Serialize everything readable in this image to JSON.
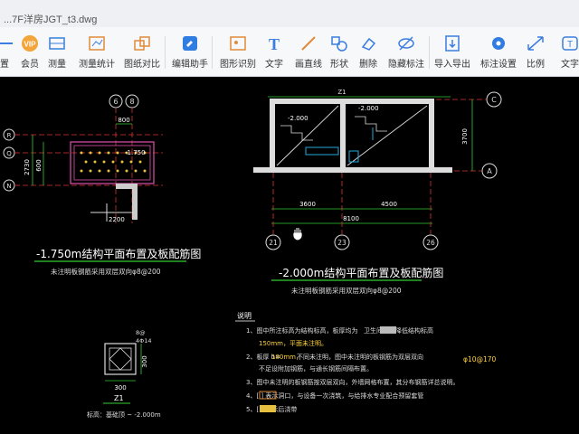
{
  "window": {
    "title": "...7F洋房JGT_t3.dwg"
  },
  "toolbar": {
    "items": [
      {
        "label": "置"
      },
      {
        "label": "会员"
      },
      {
        "label": "测量"
      },
      {
        "label": "测量统计"
      },
      {
        "label": "图纸对比"
      },
      {
        "label": "编辑助手"
      },
      {
        "label": "图形识别"
      },
      {
        "label": "文字"
      },
      {
        "label": "画直线"
      },
      {
        "label": "形状"
      },
      {
        "label": "删除"
      },
      {
        "label": "隐藏标注"
      },
      {
        "label": "导入导出"
      },
      {
        "label": "标注设置"
      },
      {
        "label": "比例"
      },
      {
        "label": "文字"
      }
    ],
    "vip_badge": "VIP"
  },
  "drawing": {
    "axis_labels": {
      "a6": "6",
      "a8": "8",
      "aR": "R",
      "aQ": "Q",
      "aN": "N",
      "aC": "C",
      "aA": "A",
      "a21": "21",
      "a23": "23",
      "a26": "26"
    },
    "dims": {
      "d800": "800",
      "d2730": "2730",
      "d600": "600",
      "dn1750": "-1.750",
      "d2200": "2200",
      "d3700": "3700",
      "d3600": "3600",
      "d4500": "4500",
      "d8100": "8100",
      "dn2000a": "-2.000",
      "dn2000b": "-2.000",
      "d300a": "300",
      "d300b": "300",
      "z1": "Z1",
      "z1b": "Z1",
      "d8at": "8@",
      "d4a14": "4Φ14"
    },
    "titles": {
      "left_title": "-1.750m结构平面布置及板配筋图",
      "left_note": "未注明板钢筋采用双层双向φ8@200",
      "mid_title": "-2.000m结构平面布置及板配筋图",
      "mid_note": "未注明板钢筋采用双层双向φ8@200",
      "col_note": "标高：基础顶 ~ -2.000m"
    },
    "notes": {
      "heading": "说明",
      "n1a": "1、图中所注标高为结构标高，板厚均为",
      "n1b": "150mm，平面未注明。",
      "n1c": "卫生间楼面降低结构标高",
      "n2a": "2、板厚 h=",
      "n2b": "180mm，",
      "n2c": "不同未注明，图中未注明的板钢筋为双层双向",
      "n2d": "φ10@170",
      "n2e": "不足设附加钢筋，与通长钢筋间隔布置。",
      "n3": "3、图中未注明的板钢筋按双层双向，外墙网格布置，其分布钢筋详总说明。",
      "n4": "4、[   ] 表示洞口，与设备一次浇筑，与给排水专业配合预留套管",
      "n5": "5、[   ] 表示后浇带"
    }
  }
}
